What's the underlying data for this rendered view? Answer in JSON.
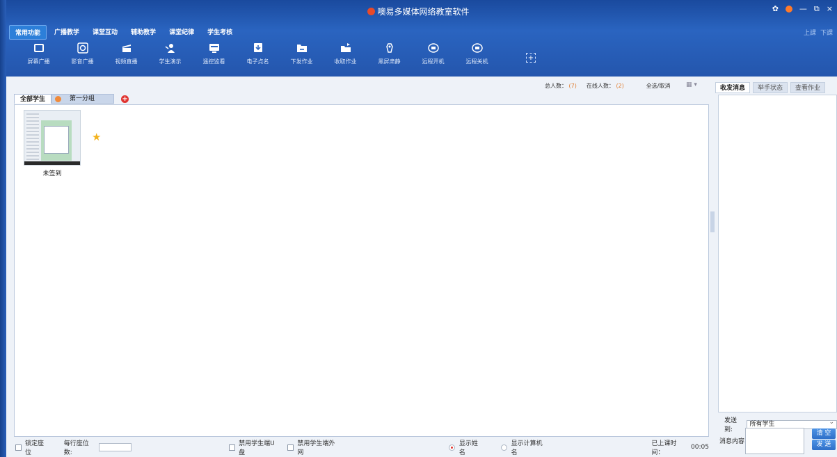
{
  "app": {
    "title": "噢易多媒体网络教室软件"
  },
  "window_controls": {
    "settings": "✿",
    "minimize": "—",
    "restore": "⧉",
    "close": "×"
  },
  "account": {
    "login": "上課",
    "logout": "下課"
  },
  "tabs": [
    {
      "label": "常用功能"
    },
    {
      "label": "广播教学"
    },
    {
      "label": "课堂互动"
    },
    {
      "label": "辅助教学"
    },
    {
      "label": "课堂纪律"
    },
    {
      "label": "学生考核"
    }
  ],
  "toolbar": [
    {
      "label": "屏幕广播",
      "icon": "screen-broadcast-icon"
    },
    {
      "label": "影音广播",
      "icon": "media-broadcast-icon"
    },
    {
      "label": "视频直播",
      "icon": "video-live-icon"
    },
    {
      "label": "学生演示",
      "icon": "student-demo-icon"
    },
    {
      "label": "遥控监看",
      "icon": "remote-monitor-icon"
    },
    {
      "label": "电子点名",
      "icon": "roll-call-icon"
    },
    {
      "label": "下发作业",
      "icon": "send-homework-icon"
    },
    {
      "label": "收取作业",
      "icon": "collect-homework-icon"
    },
    {
      "label": "黑屏肃静",
      "icon": "black-screen-icon"
    },
    {
      "label": "远程开机",
      "icon": "remote-power-on-icon"
    },
    {
      "label": "远程关机",
      "icon": "remote-shutdown-icon"
    }
  ],
  "add_tool": "+",
  "stats": {
    "total_label": "总人数：",
    "total_value": "(7)",
    "online_label": "在线人数：",
    "online_value": "(2)",
    "select_all": "全选/取消"
  },
  "group_tabs": {
    "all": "全部学生",
    "group1": "第一分组",
    "add": "+"
  },
  "students": [
    {
      "status": "未签到"
    }
  ],
  "bottom": {
    "lock_seats": "锁定座位",
    "seats_per_row": "每行座位数:",
    "disable_usb": "禁用学生端U盘",
    "disable_net": "禁用学生端外网",
    "show_name": "显示姓名",
    "show_computer": "显示计算机名",
    "class_time_label": "已上课时间：",
    "class_time": "00:05"
  },
  "right_panel": {
    "tabs": [
      "收发消息",
      "举手状态",
      "查看作业"
    ],
    "send_to_label": "发送到:",
    "send_to_value": "所有学生",
    "content_label": "消息内容:",
    "clear_button": "清 空",
    "send_button": "发 送"
  }
}
